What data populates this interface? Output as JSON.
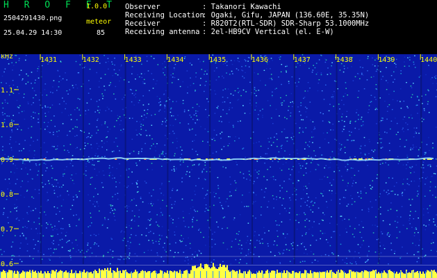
{
  "app": {
    "name": "H R O F F T",
    "version": "1.0.0"
  },
  "file_name": "2504291430.png",
  "date_time": "25.04.29 14:30",
  "meteor": {
    "label": "meteor",
    "count": "85"
  },
  "info": [
    {
      "label": "Observer",
      "value": ": Takanori Kawachi"
    },
    {
      "label": "Receiving Location",
      "value": ": Ogaki, Gifu, JAPAN (136.60E, 35.35N)"
    },
    {
      "label": "Receiver",
      "value": ": R820T2(RTL-SDR) SDR-Sharp 53.1000MHz"
    },
    {
      "label": "Receiving antenna",
      "value": ": 2el-HB9CV Vertical (el. E-W)"
    }
  ],
  "spectrogram": {
    "y_unit": "kHz",
    "y_ticks": [
      "1.1",
      "1.0",
      "0.9",
      "0.8",
      "0.7",
      "0.6"
    ],
    "x_ticks": [
      "1431",
      "1432",
      "1433",
      "1434",
      "1435",
      "1436",
      "1437",
      "1438",
      "1439",
      "1440"
    ],
    "colors": {
      "background": "#0a1aa8",
      "signal": "#ffff44",
      "grid": "#ffffff",
      "label": "#ffff00"
    }
  }
}
